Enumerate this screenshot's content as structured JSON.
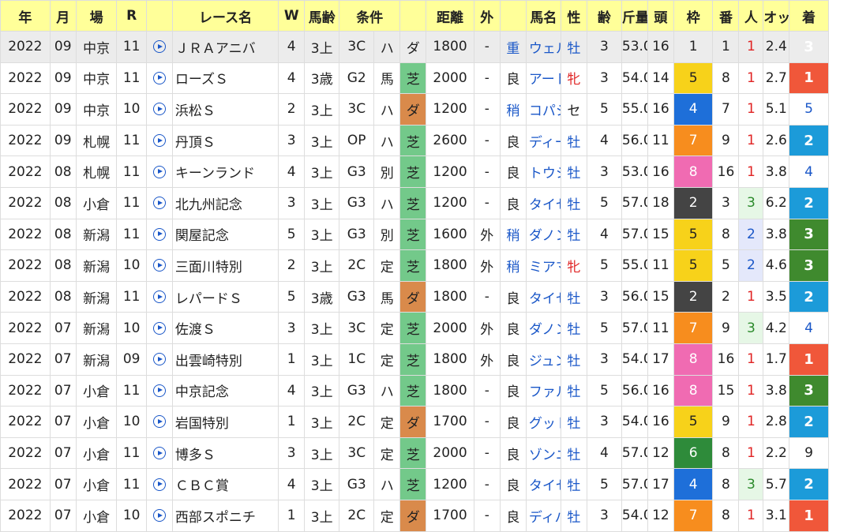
{
  "headers": [
    "年",
    "月",
    "場",
    "R",
    "",
    "レース名",
    "W",
    "馬齢",
    "条件",
    "",
    "",
    "距離",
    "外",
    "",
    "馬名",
    "性",
    "齢",
    "斤量",
    "頭",
    "枠",
    "番",
    "人",
    "オッズ",
    "着"
  ],
  "rows": [
    {
      "year": "2022",
      "month": "09",
      "venue": "中京",
      "race_no": "11",
      "race": "ＪＲＡアニバ",
      "w": "4",
      "age": "3上",
      "cls": "3C",
      "wt": "ハ",
      "surface": "ダ",
      "dist": "1800",
      "outer": "-",
      "going": "重",
      "horse": "ウェルカムニュース",
      "sex": "牡",
      "hage": "3",
      "kinryo": "53.0",
      "heads": "16",
      "waku": "1",
      "ban": "1",
      "pop": "1",
      "odds": "2.4",
      "finish": "3"
    },
    {
      "year": "2022",
      "month": "09",
      "venue": "中京",
      "race_no": "11",
      "race": "ローズＳ",
      "w": "4",
      "age": "3歳",
      "cls": "G2",
      "wt": "馬",
      "surface": "芝",
      "dist": "2000",
      "outer": "-",
      "going": "良",
      "horse": "アートハウス",
      "sex": "牝",
      "hage": "3",
      "kinryo": "54.0",
      "heads": "14",
      "waku": "5",
      "ban": "8",
      "pop": "1",
      "odds": "2.7",
      "finish": "1"
    },
    {
      "year": "2022",
      "month": "09",
      "venue": "中京",
      "race_no": "10",
      "race": "浜松Ｓ",
      "w": "2",
      "age": "3上",
      "cls": "3C",
      "wt": "ハ",
      "surface": "ダ",
      "dist": "1200",
      "outer": "-",
      "going": "稍",
      "horse": "コパシーナ",
      "sex": "セ",
      "hage": "5",
      "kinryo": "55.0",
      "heads": "16",
      "waku": "4",
      "ban": "7",
      "pop": "1",
      "odds": "5.1",
      "finish": "5"
    },
    {
      "year": "2022",
      "month": "09",
      "venue": "札幌",
      "race_no": "11",
      "race": "丹頂Ｓ",
      "w": "3",
      "age": "3上",
      "cls": "OP",
      "wt": "ハ",
      "surface": "芝",
      "dist": "2600",
      "outer": "-",
      "going": "良",
      "horse": "ディープモンスター",
      "sex": "牡",
      "hage": "4",
      "kinryo": "56.0",
      "heads": "11",
      "waku": "7",
      "ban": "9",
      "pop": "1",
      "odds": "2.6",
      "finish": "2"
    },
    {
      "year": "2022",
      "month": "08",
      "venue": "札幌",
      "race_no": "11",
      "race": "キーンランド",
      "w": "4",
      "age": "3上",
      "cls": "G3",
      "wt": "別",
      "surface": "芝",
      "dist": "1200",
      "outer": "-",
      "going": "良",
      "horse": "トウシンマカオ",
      "sex": "牡",
      "hage": "3",
      "kinryo": "53.0",
      "heads": "16",
      "waku": "8",
      "ban": "16",
      "pop": "1",
      "odds": "3.8",
      "finish": "4"
    },
    {
      "year": "2022",
      "month": "08",
      "venue": "小倉",
      "race_no": "11",
      "race": "北九州記念",
      "w": "3",
      "age": "3上",
      "cls": "G3",
      "wt": "ハ",
      "surface": "芝",
      "dist": "1200",
      "outer": "-",
      "going": "良",
      "horse": "タイセイビジョン",
      "sex": "牡",
      "hage": "5",
      "kinryo": "57.0",
      "heads": "18",
      "waku": "2",
      "ban": "3",
      "pop": "3",
      "odds": "6.2",
      "finish": "2"
    },
    {
      "year": "2022",
      "month": "08",
      "venue": "新潟",
      "race_no": "11",
      "race": "関屋記念",
      "w": "5",
      "age": "3上",
      "cls": "G3",
      "wt": "別",
      "surface": "芝",
      "dist": "1600",
      "outer": "外",
      "going": "稍",
      "horse": "ダノンザキッド",
      "sex": "牡",
      "hage": "4",
      "kinryo": "57.0",
      "heads": "15",
      "waku": "5",
      "ban": "8",
      "pop": "2",
      "odds": "3.8",
      "finish": "3"
    },
    {
      "year": "2022",
      "month": "08",
      "venue": "新潟",
      "race_no": "10",
      "race": "三面川特別",
      "w": "2",
      "age": "3上",
      "cls": "2C",
      "wt": "定",
      "surface": "芝",
      "dist": "1800",
      "outer": "外",
      "going": "稍",
      "horse": "ミアマンテ",
      "sex": "牝",
      "hage": "5",
      "kinryo": "55.0",
      "heads": "11",
      "waku": "5",
      "ban": "5",
      "pop": "2",
      "odds": "4.6",
      "finish": "3"
    },
    {
      "year": "2022",
      "month": "08",
      "venue": "新潟",
      "race_no": "11",
      "race": "レパードＳ",
      "w": "5",
      "age": "3歳",
      "cls": "G3",
      "wt": "馬",
      "surface": "ダ",
      "dist": "1800",
      "outer": "-",
      "going": "良",
      "horse": "タイセイドレフォン",
      "sex": "牡",
      "hage": "3",
      "kinryo": "56.0",
      "heads": "15",
      "waku": "2",
      "ban": "2",
      "pop": "1",
      "odds": "3.5",
      "finish": "2"
    },
    {
      "year": "2022",
      "month": "07",
      "venue": "新潟",
      "race_no": "10",
      "race": "佐渡Ｓ",
      "w": "3",
      "age": "3上",
      "cls": "3C",
      "wt": "定",
      "surface": "芝",
      "dist": "2000",
      "outer": "外",
      "going": "良",
      "horse": "ダノンレガーロ",
      "sex": "牡",
      "hage": "5",
      "kinryo": "57.0",
      "heads": "11",
      "waku": "7",
      "ban": "9",
      "pop": "3",
      "odds": "4.2",
      "finish": "4"
    },
    {
      "year": "2022",
      "month": "07",
      "venue": "新潟",
      "race_no": "09",
      "race": "出雲崎特別",
      "w": "1",
      "age": "3上",
      "cls": "1C",
      "wt": "定",
      "surface": "芝",
      "dist": "1800",
      "outer": "外",
      "going": "良",
      "horse": "ジュンブロッサム",
      "sex": "牡",
      "hage": "3",
      "kinryo": "54.0",
      "heads": "17",
      "waku": "8",
      "ban": "16",
      "pop": "1",
      "odds": "1.7",
      "finish": "1"
    },
    {
      "year": "2022",
      "month": "07",
      "venue": "小倉",
      "race_no": "11",
      "race": "中京記念",
      "w": "4",
      "age": "3上",
      "cls": "G3",
      "wt": "ハ",
      "surface": "芝",
      "dist": "1800",
      "outer": "-",
      "going": "良",
      "horse": "ファルコニア",
      "sex": "牡",
      "hage": "5",
      "kinryo": "56.0",
      "heads": "16",
      "waku": "8",
      "ban": "15",
      "pop": "1",
      "odds": "3.8",
      "finish": "3"
    },
    {
      "year": "2022",
      "month": "07",
      "venue": "小倉",
      "race_no": "10",
      "race": "岩国特別",
      "w": "1",
      "age": "3上",
      "cls": "2C",
      "wt": "定",
      "surface": "ダ",
      "dist": "1700",
      "outer": "-",
      "going": "良",
      "horse": "グットディール",
      "sex": "牡",
      "hage": "3",
      "kinryo": "54.0",
      "heads": "16",
      "waku": "5",
      "ban": "9",
      "pop": "1",
      "odds": "2.8",
      "finish": "2"
    },
    {
      "year": "2022",
      "month": "07",
      "venue": "小倉",
      "race_no": "11",
      "race": "博多Ｓ",
      "w": "3",
      "age": "3上",
      "cls": "3C",
      "wt": "定",
      "surface": "芝",
      "dist": "2000",
      "outer": "-",
      "going": "良",
      "horse": "ゾンニッヒ",
      "sex": "牡",
      "hage": "4",
      "kinryo": "57.0",
      "heads": "12",
      "waku": "6",
      "ban": "8",
      "pop": "1",
      "odds": "2.2",
      "finish": "9"
    },
    {
      "year": "2022",
      "month": "07",
      "venue": "小倉",
      "race_no": "11",
      "race": "ＣＢＣ賞",
      "w": "4",
      "age": "3上",
      "cls": "G3",
      "wt": "ハ",
      "surface": "芝",
      "dist": "1200",
      "outer": "-",
      "going": "良",
      "horse": "タイセイビジョン",
      "sex": "牡",
      "hage": "5",
      "kinryo": "57.0",
      "heads": "17",
      "waku": "4",
      "ban": "8",
      "pop": "3",
      "odds": "5.7",
      "finish": "2"
    },
    {
      "year": "2022",
      "month": "07",
      "venue": "小倉",
      "race_no": "10",
      "race": "西部スポニチ",
      "w": "1",
      "age": "3上",
      "cls": "2C",
      "wt": "定",
      "surface": "ダ",
      "dist": "1700",
      "outer": "-",
      "going": "良",
      "horse": "ディパッセ",
      "sex": "牡",
      "hage": "3",
      "kinryo": "54.0",
      "heads": "12",
      "waku": "7",
      "ban": "8",
      "pop": "1",
      "odds": "3.1",
      "finish": "1"
    }
  ],
  "colors": {
    "header_bg": "#ffff99",
    "turf": "#73c98a",
    "dirt": "#d98a4b",
    "link": "#1a57c8",
    "red": "#e02424"
  }
}
